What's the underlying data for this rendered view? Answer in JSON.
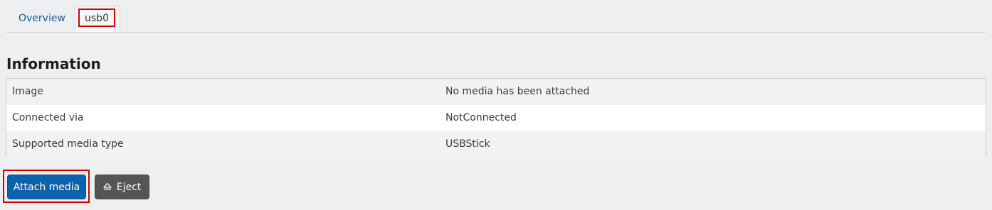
{
  "tabs": [
    {
      "label": "Overview",
      "active": false
    },
    {
      "label": "usb0",
      "active": true
    }
  ],
  "section": {
    "title": "Information"
  },
  "info": {
    "rows": [
      {
        "key": "Image",
        "value": "No media has been attached"
      },
      {
        "key": "Connected via",
        "value": "NotConnected"
      },
      {
        "key": "Supported media type",
        "value": "USBStick"
      }
    ]
  },
  "actions": {
    "attach_label": "Attach media",
    "eject_label": "Eject"
  },
  "icons": {
    "eject": "eject-icon"
  },
  "colors": {
    "primary": "#0b63ac",
    "secondary": "#555555",
    "link": "#0b5d9c",
    "highlight": "#d20000"
  }
}
